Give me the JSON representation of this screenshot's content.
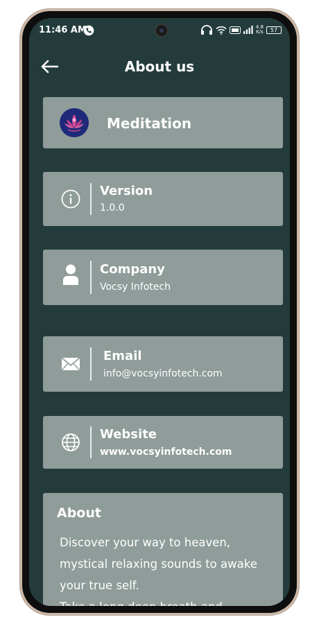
{
  "status_bar": {
    "time": "11:46 AM",
    "net_speed_value": "4.8",
    "net_speed_unit": "K/s",
    "battery": "57"
  },
  "app_bar": {
    "title": "About us"
  },
  "app_card": {
    "name": "Meditation"
  },
  "info_items": [
    {
      "label": "Version",
      "value": "1.0.0",
      "icon": "info-icon"
    },
    {
      "label": "Company",
      "value": "Vocsy Infotech",
      "icon": "person-icon"
    },
    {
      "label": "Email",
      "value": "info@vocsyinfotech.com",
      "icon": "mail-icon"
    },
    {
      "label": "Website",
      "value": "www.vocsyinfotech.com",
      "icon": "globe-icon"
    }
  ],
  "about": {
    "title": "About",
    "text": "Discover your way to heaven,\nmystical relaxing sounds to awake\nyour true self.\nTake a long deep breath and"
  },
  "colors": {
    "background": "#233c3b",
    "card": "#8f9c9a",
    "text": "#ffffff",
    "logo_bg": "#1e2a79",
    "lotus": "#d94d9a"
  }
}
